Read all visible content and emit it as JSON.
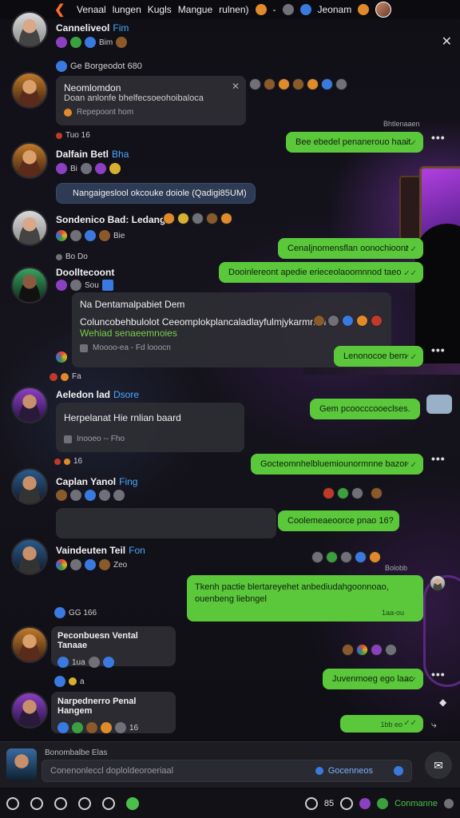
{
  "status_bar": {
    "text1": "Venaal",
    "text2": "lungen",
    "text3": "Kugls",
    "text4": "Mangue",
    "text5": "rulnen)",
    "text6": "Jeonam"
  },
  "messages": {
    "m1": {
      "name": "Canneliveol",
      "tag": "Fim",
      "icons": "Bim"
    },
    "m2_header": "Ge Borgeodot 680",
    "m2": {
      "title": "Neomlomdon",
      "body": "Doan anlonfe bhelfecsoeohoibaloca",
      "meta": "Repepoont hom"
    },
    "m3_meta": "Tuo 16",
    "m3_ts": "Bhtlenaaen",
    "g1": "Bee ebedel penanerouo haait",
    "m4": {
      "name": "Dalfain Betl",
      "tag": "Bha",
      "icons": "Bi"
    },
    "blue1": "Nangaigeslool okcouke doiole (Qadigi85UM)",
    "m5": {
      "name": "Sondenico Bad: Ledangi",
      "icons": "Bie"
    },
    "g2": "Cenaljnomensflan oonochioont",
    "m6_meta": "Bo Do",
    "g3": "Dooinlereont apedie erieceolaoomnnod taeo",
    "m6": {
      "name": "Doolltecoont",
      "icons": "Sou"
    },
    "m7": {
      "title": "Na Dentamalpabiet Dem",
      "body": "Coluncobehbulolot Ceeomplokplancaladlayfulmjykarmnan",
      "hl": "Wehiad senaeemnoies",
      "meta": "Moooo-ea - Fd looocn"
    },
    "g4": "Lenonocoe bern",
    "m8_meta": "Fa",
    "m8": {
      "name": "Aeledon lad",
      "tag": "Dsore"
    },
    "m9": {
      "title": "Herpelanat Hie rnlian baard",
      "meta": "Inooeo -- Fho"
    },
    "g5": "Gem pcoocccooeclses.",
    "m10_meta": "16",
    "g6": "Gocteomnhelbluemiounormnne bazor",
    "m10": {
      "name": "Caplan Yanol",
      "tag": "Fing"
    },
    "g7": "Coolemeaeoorce pnao 16?",
    "m11": {
      "name": "Vaindeuten Teil",
      "tag": "Fon",
      "icons": "Zeo"
    },
    "m11_ts": "Bolobb",
    "g8": "Tkenh pactie blertareyehet anbediudahgoonnoao, ouenbeng liebngel",
    "g8_time": "1aa-ou",
    "m12_meta": "GG 166",
    "m12": {
      "name": "Peconbuesn Vental Tanaae",
      "icons": "1ua"
    },
    "m13_meta": "a",
    "g9": "Juvenmoeg ego laac",
    "m13": {
      "name": "Narpednerro Penal Hangem",
      "icons": "16"
    },
    "g10_time": "1bb eo"
  },
  "composer": {
    "label": "Bonombalbe Elas",
    "placeholder": "Conenonleccl doploldeoroeriaal",
    "right_text": "Gocenneos"
  },
  "bottombar": {
    "count": "85",
    "label": "Conmanne"
  },
  "colors": {
    "accent_green": "#5ac83a",
    "accent_blue": "#4aa8ff",
    "accent_orange": "#ff6a2a"
  }
}
